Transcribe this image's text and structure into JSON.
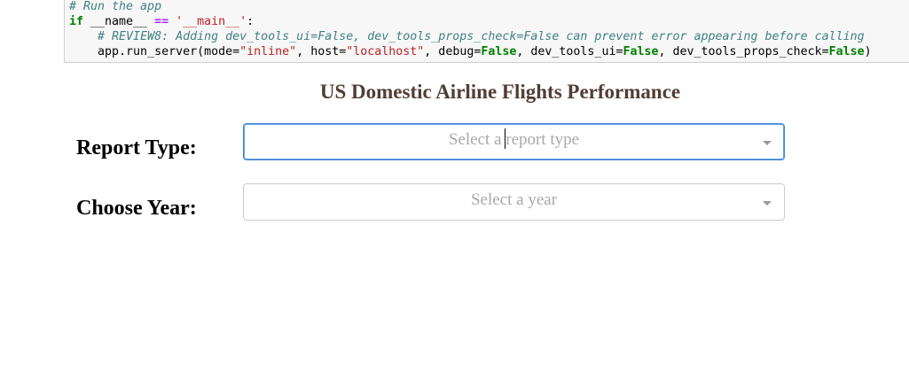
{
  "notebook": {
    "code_lines": [
      [
        {
          "t": "# Run the app",
          "c": "cm"
        }
      ],
      [
        {
          "t": "if",
          "c": "kw"
        },
        {
          "t": " __name__ ",
          "c": ""
        },
        {
          "t": "==",
          "c": "op"
        },
        {
          "t": " ",
          "c": ""
        },
        {
          "t": "'__main__'",
          "c": "st"
        },
        {
          "t": ":",
          "c": ""
        }
      ],
      [
        {
          "t": "    ",
          "c": ""
        },
        {
          "t": "# REVIEW8: Adding dev_tools_ui=False, dev_tools_props_check=False can prevent error appearing before calling",
          "c": "cm"
        }
      ],
      [
        {
          "t": "    app.run_server(mode=",
          "c": ""
        },
        {
          "t": "\"inline\"",
          "c": "st"
        },
        {
          "t": ", host=",
          "c": ""
        },
        {
          "t": "\"localhost\"",
          "c": "st"
        },
        {
          "t": ", debug=",
          "c": ""
        },
        {
          "t": "False",
          "c": "kw"
        },
        {
          "t": ", dev_tools_ui=",
          "c": ""
        },
        {
          "t": "False",
          "c": "kw"
        },
        {
          "t": ", dev_tools_props_check=",
          "c": ""
        },
        {
          "t": "False",
          "c": "kw"
        },
        {
          "t": ")",
          "c": ""
        }
      ]
    ]
  },
  "dashboard": {
    "title": "US Domestic Airline Flights Performance",
    "report_type": {
      "label": "Report Type:",
      "placeholder": "Select a report type"
    },
    "year": {
      "label": "Choose Year:",
      "placeholder": "Select a year"
    }
  },
  "colors": {
    "title": "#503D36",
    "focus_border": "#3b82d8"
  }
}
